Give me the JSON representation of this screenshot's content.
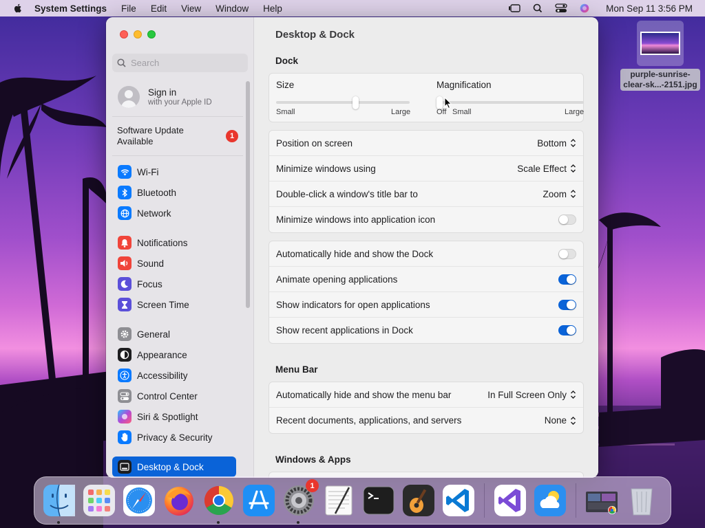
{
  "menubar": {
    "app_name": "System Settings",
    "items": [
      "File",
      "Edit",
      "View",
      "Window",
      "Help"
    ],
    "clock": "Mon Sep 11  3:56 PM"
  },
  "desktop_file": {
    "name_line1": "purple-sunrise-",
    "name_line2": "clear-sk...-2151.jpg"
  },
  "window": {
    "title": "Desktop & Dock"
  },
  "sidebar": {
    "search_placeholder": "Search",
    "account": {
      "name": "Sign in",
      "sub": "with your Apple ID"
    },
    "update": {
      "line1": "Software Update",
      "line2": "Available",
      "badge": "1"
    },
    "groups": [
      [
        {
          "label": "Wi-Fi",
          "icon": "wifi-icon",
          "color": "#0a7aff"
        },
        {
          "label": "Bluetooth",
          "icon": "bluetooth-icon",
          "color": "#0a7aff"
        },
        {
          "label": "Network",
          "icon": "globe-icon",
          "color": "#0a7aff"
        }
      ],
      [
        {
          "label": "Notifications",
          "icon": "bell-icon",
          "color": "#f0443a"
        },
        {
          "label": "Sound",
          "icon": "speaker-icon",
          "color": "#f0443a"
        },
        {
          "label": "Focus",
          "icon": "moon-icon",
          "color": "#5b4fd9"
        },
        {
          "label": "Screen Time",
          "icon": "hourglass-icon",
          "color": "#5b4fd9"
        }
      ],
      [
        {
          "label": "General",
          "icon": "gear-icon",
          "color": "#8e8e93"
        },
        {
          "label": "Appearance",
          "icon": "appearance-icon",
          "color": "#1d1d1f"
        },
        {
          "label": "Accessibility",
          "icon": "accessibility-icon",
          "color": "#0a7aff"
        },
        {
          "label": "Control Center",
          "icon": "control-center-icon",
          "color": "#8e8e93"
        },
        {
          "label": "Siri & Spotlight",
          "icon": "siri-icon",
          "color": "#b24ad6"
        },
        {
          "label": "Privacy & Security",
          "icon": "hand-icon",
          "color": "#0a7aff"
        }
      ]
    ],
    "active": {
      "label": "Desktop & Dock",
      "icon": "dock-icon",
      "color": "#1d1d1f"
    }
  },
  "dock_section": {
    "title": "Dock",
    "size": {
      "label": "Size",
      "min": "Small",
      "max": "Large",
      "value": 0.6
    },
    "magnification": {
      "label": "Magnification",
      "off": "Off",
      "min": "Small",
      "max": "Large",
      "value": 0.0
    },
    "popups": [
      {
        "label": "Position on screen",
        "value": "Bottom"
      },
      {
        "label": "Minimize windows using",
        "value": "Scale Effect"
      },
      {
        "label": "Double-click a window's title bar to",
        "value": "Zoom"
      }
    ],
    "minimize_into_icon": {
      "label": "Minimize windows into application icon",
      "on": false
    },
    "toggles": [
      {
        "label": "Automatically hide and show the Dock",
        "on": false
      },
      {
        "label": "Animate opening applications",
        "on": true
      },
      {
        "label": "Show indicators for open applications",
        "on": true
      },
      {
        "label": "Show recent applications in Dock",
        "on": true
      }
    ]
  },
  "menubar_section": {
    "title": "Menu Bar",
    "rows": [
      {
        "label": "Automatically hide and show the menu bar",
        "value": "In Full Screen Only"
      },
      {
        "label": "Recent documents, applications, and servers",
        "value": "None"
      }
    ]
  },
  "windows_section": {
    "title": "Windows & Apps"
  },
  "dock": {
    "apps": [
      {
        "name": "finder",
        "running": true
      },
      {
        "name": "launchpad",
        "running": false
      },
      {
        "name": "safari",
        "running": false
      },
      {
        "name": "firefox",
        "running": false
      },
      {
        "name": "chrome",
        "running": true
      },
      {
        "name": "app-store",
        "running": false
      },
      {
        "name": "system-settings",
        "running": true,
        "badge": "1"
      },
      {
        "name": "textedit",
        "running": false
      },
      {
        "name": "terminal",
        "running": false
      },
      {
        "name": "garageband",
        "running": false
      },
      {
        "name": "vscode",
        "running": false
      },
      {
        "name": "visual-studio",
        "running": false
      },
      {
        "name": "weather",
        "running": false
      },
      {
        "name": "downloads-stack",
        "running": false
      },
      {
        "name": "trash",
        "running": false
      }
    ]
  }
}
